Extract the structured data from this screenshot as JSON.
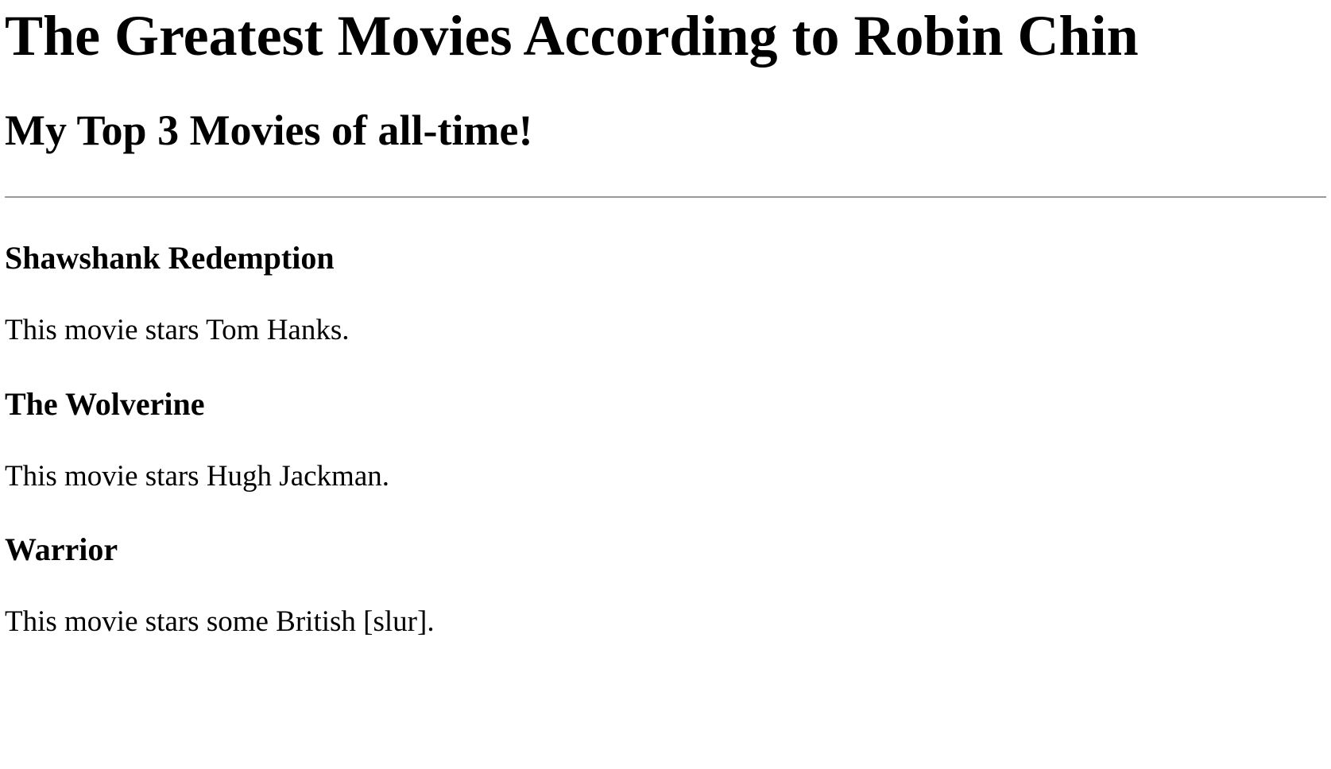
{
  "page": {
    "title": "The Greatest Movies According to Robin Chin",
    "subtitle": "My Top 3 Movies of all-time!"
  },
  "movies": [
    {
      "title": "Shawshank Redemption",
      "description": "This movie stars Tom Hanks."
    },
    {
      "title": "The Wolverine",
      "description": "This movie stars Hugh Jackman."
    },
    {
      "title": "Warrior",
      "description": "This movie stars some British [slur]."
    }
  ],
  "colors": {
    "text": "#000000",
    "background": "#ffffff",
    "divider": "#9a9a9a"
  }
}
